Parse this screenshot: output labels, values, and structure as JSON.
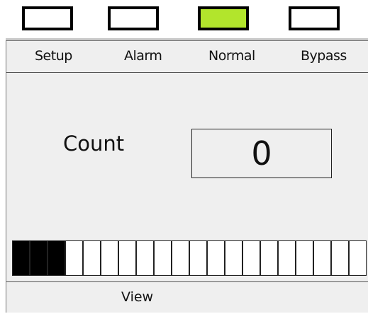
{
  "status_leds": [
    {
      "name": "Setup",
      "active": false,
      "color": "#ffffff"
    },
    {
      "name": "Alarm",
      "active": false,
      "color": "#ffffff"
    },
    {
      "name": "Normal",
      "active": true,
      "color": "#b2e52c"
    },
    {
      "name": "Bypass",
      "active": false,
      "color": "#ffffff"
    }
  ],
  "tabs": [
    {
      "label": "Setup"
    },
    {
      "label": "Alarm"
    },
    {
      "label": "Normal"
    },
    {
      "label": "Bypass"
    }
  ],
  "counter": {
    "label": "Count",
    "value": "0"
  },
  "level_bar": {
    "segments": 20,
    "filled": 3
  },
  "footer": {
    "view_label": "View"
  }
}
